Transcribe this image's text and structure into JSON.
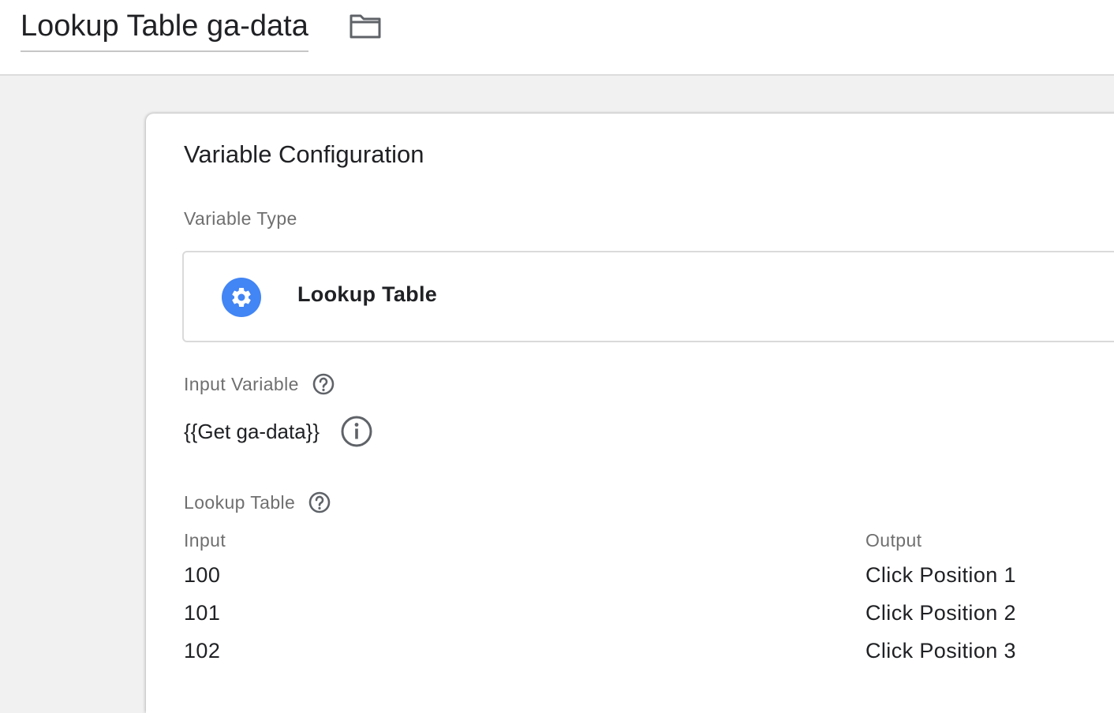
{
  "header": {
    "title": "Lookup Table ga-data",
    "folder_icon": "folder-icon"
  },
  "card": {
    "title": "Variable Configuration",
    "variable_type": {
      "label": "Variable Type",
      "icon": "gear-icon",
      "icon_color": "#4285f4",
      "name": "Lookup Table"
    },
    "input_variable": {
      "label": "Input Variable",
      "value": "{{Get ga-data}}"
    },
    "lookup_table": {
      "label": "Lookup Table",
      "columns": [
        "Input",
        "Output"
      ],
      "rows": [
        {
          "input": "100",
          "output": "Click Position 1"
        },
        {
          "input": "101",
          "output": "Click Position 2"
        },
        {
          "input": "102",
          "output": "Click Position 3"
        }
      ]
    }
  }
}
